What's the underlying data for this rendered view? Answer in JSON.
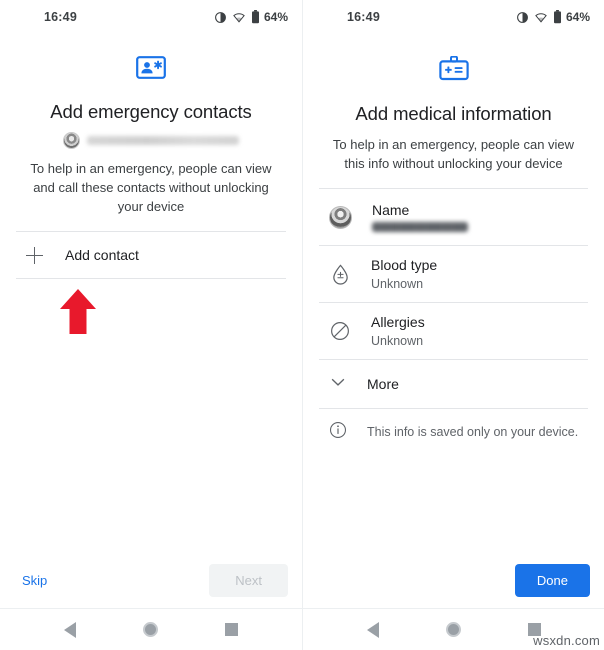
{
  "statusbar": {
    "time": "16:49",
    "battery_pct": "64%",
    "icons": [
      "dnd-icon",
      "wifi-icon",
      "battery-icon"
    ]
  },
  "colors": {
    "accent_blue": "#1a73e8",
    "icon_blue": "#1a73e8",
    "text_primary": "#202124",
    "text_secondary": "#5f6368",
    "divider": "#e3e5e8",
    "annotation_red": "#e8192c",
    "disabled_bg": "#f1f3f4",
    "disabled_text": "#bdc1c6"
  },
  "left_screen": {
    "hero_icon": "contact-card-star-icon",
    "title": "Add emergency contacts",
    "account": {
      "avatar": "account-avatar",
      "email_redacted": "██████████████████"
    },
    "subtitle": "To help in an emergency, people can view and call these contacts without unlocking your device",
    "add_contact_label": "Add contact",
    "annotation": "red-up-arrow",
    "skip_label": "Skip",
    "next_label": "Next"
  },
  "right_screen": {
    "hero_icon": "medical-id-badge-icon",
    "title": "Add medical information",
    "subtitle": "To help in an emergency, people can view this info without unlocking your device",
    "rows": [
      {
        "icon": "avatar-icon",
        "label": "Name",
        "value": "███████████",
        "redacted": true
      },
      {
        "icon": "blood-drop-icon",
        "label": "Blood type",
        "value": "Unknown",
        "redacted": false
      },
      {
        "icon": "allergy-icon",
        "label": "Allergies",
        "value": "Unknown",
        "redacted": false
      }
    ],
    "more_label": "More",
    "more_icon": "chevron-down-icon",
    "info_icon": "info-icon",
    "info_text": "This info is saved only on your device.",
    "done_label": "Done"
  },
  "navbar": {
    "back": "back-triangle-icon",
    "home": "home-circle-icon",
    "recents": "recents-square-icon"
  },
  "watermark": "wsxdn.com"
}
